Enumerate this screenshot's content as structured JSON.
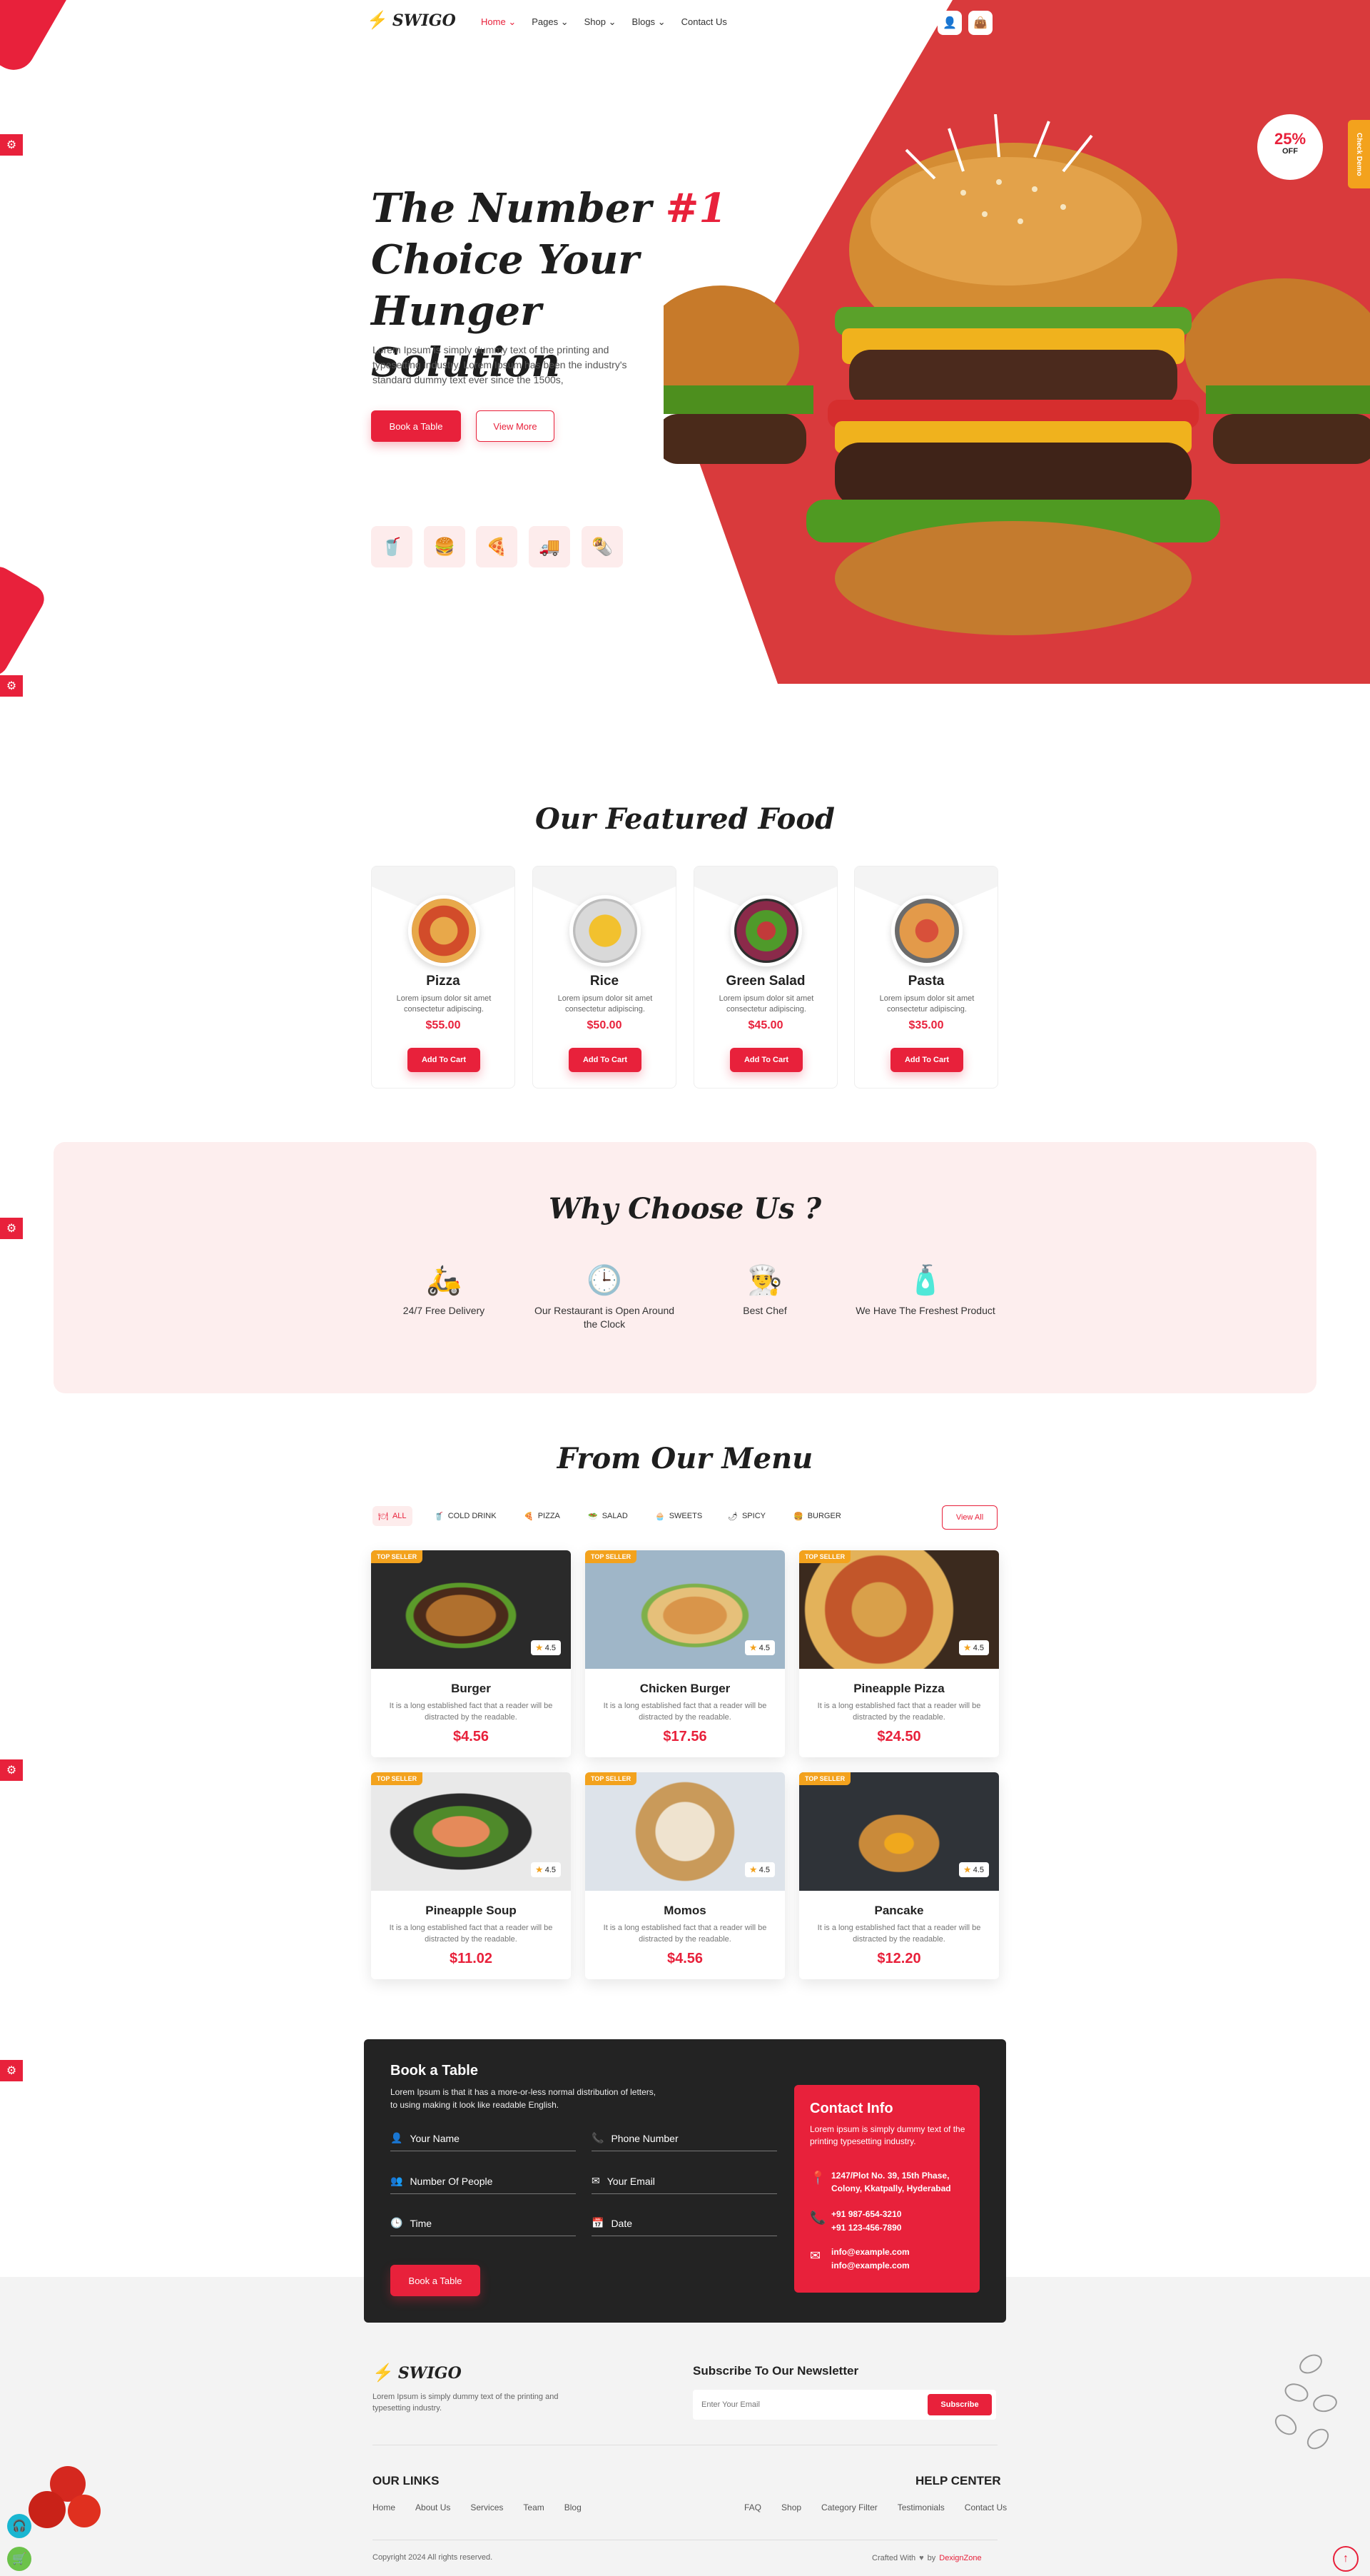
{
  "header": {
    "logo": "SWIGO",
    "nav": [
      {
        "label": "Home"
      },
      {
        "label": "Pages"
      },
      {
        "label": "Shop"
      },
      {
        "label": "Blogs"
      },
      {
        "label": "Contact Us"
      }
    ]
  },
  "side_tab": "Check Demo",
  "hero": {
    "title_line1": "The Number ",
    "title_highlight": "#1",
    "title_line2": "Choice Your Hunger",
    "title_line3": "Solution",
    "description": "Lorem Ipsum is simply dummy text of the printing and typesetting industry. Lorem Ipsum has been the industry's standard dummy text ever since the 1500s,",
    "primary_button": "Book a Table",
    "secondary_button": "View More",
    "discount_value": "25%",
    "discount_label": "OFF",
    "category_icons": [
      "drink-icon",
      "burger-icon",
      "pizza-icon",
      "food-truck-icon",
      "burrito-icon"
    ]
  },
  "featured": {
    "title": "Our Featured Food",
    "items": [
      {
        "name": "Pizza",
        "desc": "Lorem ipsum dolor sit amet consectetur adipiscing.",
        "price": "$55.00",
        "button": "Add To Cart"
      },
      {
        "name": "Rice",
        "desc": "Lorem ipsum dolor sit amet consectetur adipiscing.",
        "price": "$50.00",
        "button": "Add To Cart"
      },
      {
        "name": "Green Salad",
        "desc": "Lorem ipsum dolor sit amet consectetur adipiscing.",
        "price": "$45.00",
        "button": "Add To Cart"
      },
      {
        "name": "Pasta",
        "desc": "Lorem ipsum dolor sit amet consectetur adipiscing.",
        "price": "$35.00",
        "button": "Add To Cart"
      }
    ]
  },
  "why": {
    "title": "Why Choose Us ?",
    "items": [
      {
        "label": "24/7 Free Delivery"
      },
      {
        "label": "Our Restaurant is Open Around the Clock"
      },
      {
        "label": "Best Chef"
      },
      {
        "label": "We Have The Freshest Product"
      }
    ]
  },
  "menu": {
    "title": "From Our Menu",
    "tabs": [
      "ALL",
      "COLD DRINK",
      "PIZZA",
      "SALAD",
      "SWEETS",
      "SPICY",
      "BURGER"
    ],
    "view_all": "View All",
    "badge": "TOP SELLER",
    "desc": "It is a long established fact that a reader will be distracted by the readable.",
    "items": [
      {
        "name": "Burger",
        "price": "$4.56",
        "rating": "4.5"
      },
      {
        "name": "Chicken Burger",
        "price": "$17.56",
        "rating": "4.5"
      },
      {
        "name": "Pineapple Pizza",
        "price": "$24.50",
        "rating": "4.5"
      },
      {
        "name": "Pineapple Soup",
        "price": "$11.02",
        "rating": "4.5"
      },
      {
        "name": "Momos",
        "price": "$4.56",
        "rating": "4.5"
      },
      {
        "name": "Pancake",
        "price": "$12.20",
        "rating": "4.5"
      }
    ]
  },
  "booking": {
    "title": "Book a Table",
    "description": "Lorem Ipsum is that it has a more-or-less normal distribution of letters, to using making it look like readable English.",
    "fields": {
      "name": "Your Name",
      "phone": "Phone Number",
      "people": "Number Of People",
      "email": "Your Email",
      "time": "Time",
      "date": "Date"
    },
    "button": "Book a Table",
    "contact": {
      "title": "Contact Info",
      "description": "Lorem ipsum is simply dummy text of the printing typesetting industry.",
      "address": "1247/Plot No. 39, 15th Phase, Colony, Kkatpally, Hyderabad",
      "phone1": "+91 987-654-3210",
      "phone2": "+91 123-456-7890",
      "email1": "info@example.com",
      "email2": "info@example.com"
    }
  },
  "footer": {
    "logo": "SWIGO",
    "about": "Lorem Ipsum is simply dummy text of the printing and typesetting industry.",
    "newsletter_title": "Subscribe To Our Newsletter",
    "newsletter_placeholder": "Enter Your Email",
    "subscribe": "Subscribe",
    "our_links_title": "OUR LINKS",
    "our_links": [
      "Home",
      "About Us",
      "Services",
      "Team",
      "Blog"
    ],
    "help_title": "HELP CENTER",
    "help_links": [
      "FAQ",
      "Shop",
      "Category Filter",
      "Testimonials",
      "Contact Us"
    ],
    "copyright": "Copyright 2024 All rights reserved.",
    "crafted_prefix": "Crafted With",
    "crafted_by": "by",
    "crafted_brand": "DexignZone"
  },
  "colors": {
    "accent": "#e8213b",
    "badge": "#f3a21d",
    "dark": "#232323",
    "pink_bg": "#fdeeee"
  }
}
